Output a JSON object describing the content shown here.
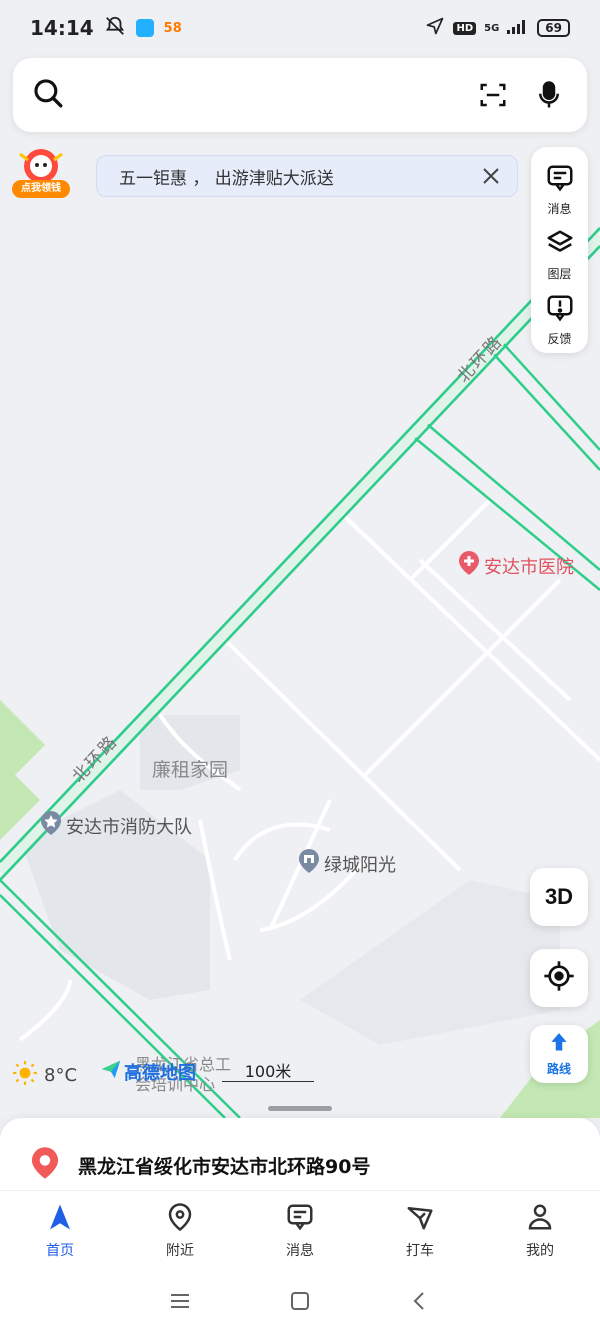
{
  "status": {
    "time": "14:14",
    "app_badge": "58",
    "network": "5G",
    "hd": "HD",
    "battery": "69"
  },
  "search": {
    "placeholder": ""
  },
  "promo": {
    "label": "点我领钱"
  },
  "banner": {
    "text": "五一钜惠 ， 出游津贴大派送"
  },
  "side_panel": {
    "items": [
      {
        "label": "消息",
        "icon": "message-icon"
      },
      {
        "label": "图层",
        "icon": "layers-icon"
      },
      {
        "label": "反馈",
        "icon": "feedback-icon"
      }
    ]
  },
  "map": {
    "roads": [
      {
        "label": "北环路"
      },
      {
        "label": "北环路"
      }
    ],
    "pois": [
      {
        "label": "安达市医院",
        "icon": "hospital-pin-icon"
      },
      {
        "label": "廉租家园"
      },
      {
        "label": "安达市消防大队",
        "icon": "star-pin-icon"
      },
      {
        "label": "绿城阳光",
        "icon": "building-pin-icon"
      },
      {
        "label": "黑龙江省总工会培训中心",
        "line1": "黑龙江省总工",
        "line2": "会培训中心"
      }
    ],
    "weather": {
      "temperature": "8°C",
      "icon": "sun-icon"
    },
    "logo": "高德地图",
    "scale": "100米",
    "colors": {
      "road_green": "#2fce8a",
      "park_green": "#bfe8b0",
      "accent_blue": "#1f5fe6",
      "pin_red": "#e85a6a"
    }
  },
  "controls": {
    "three_d": "3D",
    "route": "路线"
  },
  "sheet": {
    "address": "黑龙江省绥化市安达市北环路90号"
  },
  "tabbar": {
    "tabs": [
      {
        "label": "首页",
        "active": true
      },
      {
        "label": "附近"
      },
      {
        "label": "消息"
      },
      {
        "label": "打车"
      },
      {
        "label": "我的"
      }
    ]
  }
}
